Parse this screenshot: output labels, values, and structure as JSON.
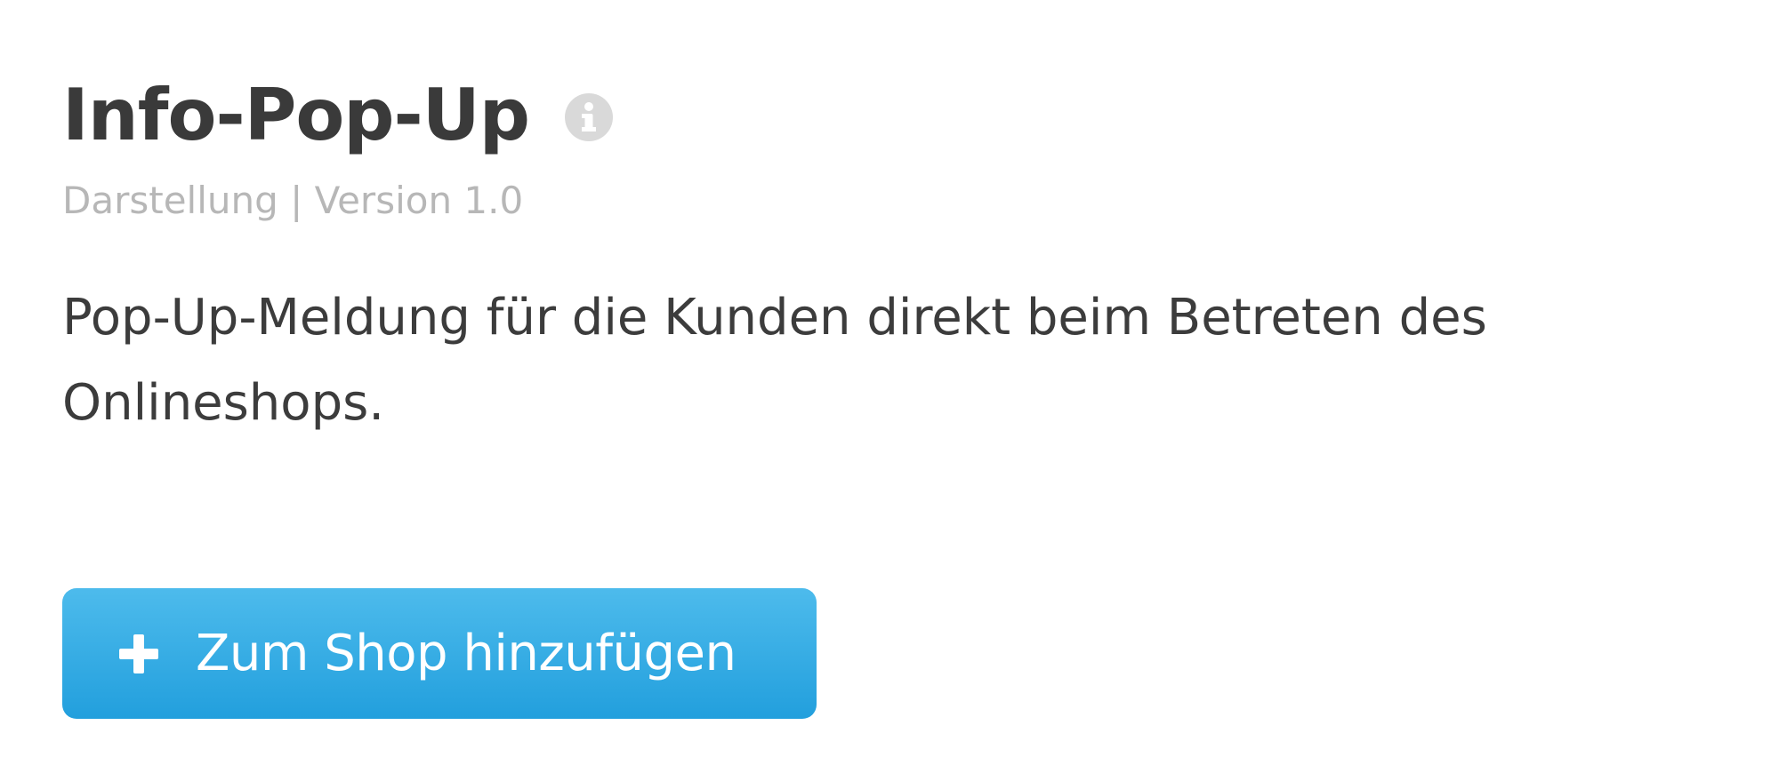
{
  "plugin": {
    "title": "Info-Pop-Up",
    "meta": "Darstellung | Version 1.0",
    "description": "Pop-Up-Meldung für die Kunden direkt beim Betreten des Onlineshops.",
    "add_button_label": "Zum Shop hinzufügen",
    "info_icon": "info-icon",
    "add_icon": "plus-icon"
  },
  "colors": {
    "title": "#3a3a3a",
    "meta": "#b7b7b7",
    "description": "#3c3c3c",
    "button_top": "#4dbbec",
    "button_bottom": "#229fdd",
    "info_icon_bg": "#d9d9d9"
  }
}
